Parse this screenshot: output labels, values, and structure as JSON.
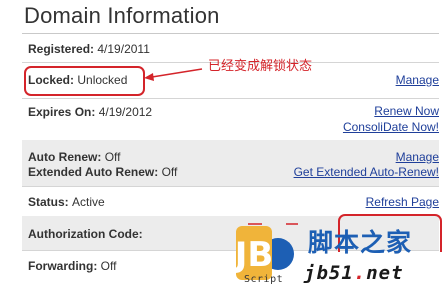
{
  "page": {
    "title": "Domain Information"
  },
  "fields": {
    "registered": {
      "label": "Registered:",
      "value": "4/19/2011"
    },
    "locked": {
      "label": "Locked:",
      "value": "Unlocked",
      "action": "Manage"
    },
    "expires": {
      "label": "Expires On:",
      "value": "4/19/2012",
      "action1": "Renew Now",
      "action2": "ConsoliDate Now!"
    },
    "auto_renew": {
      "label": "Auto Renew:",
      "value": "Off",
      "action": "Manage"
    },
    "extended_auto_renew": {
      "label": "Extended Auto Renew:",
      "value": "Off",
      "action": "Get Extended Auto-Renew!"
    },
    "status": {
      "label": "Status:",
      "value": "Active",
      "action": "Refresh Page"
    },
    "authorization_code": {
      "label": "Authorization Code:"
    },
    "forwarding": {
      "label": "Forwarding:",
      "value": "Off"
    }
  },
  "annotation": {
    "text": "已经变成解锁状态",
    "color": "#d4242a"
  },
  "watermark": {
    "logo_letters": "JB",
    "script": "Script",
    "site_name": "脚本之家",
    "url_prefix": "jb51",
    "url_dot": ".",
    "url_suffix": "net"
  },
  "colors": {
    "link": "#1f3f9a",
    "shaded_row": "#ececec",
    "annotation_red": "#d4242a"
  }
}
